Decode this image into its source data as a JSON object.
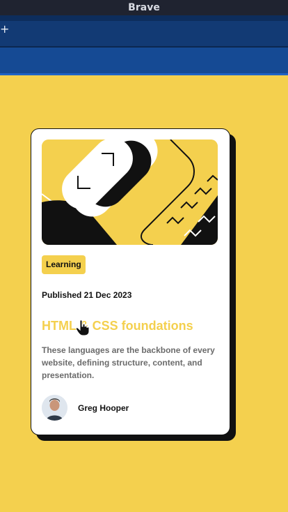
{
  "window": {
    "title": "Brave"
  },
  "tabstrip": {
    "new_tab_glyph": "+"
  },
  "card": {
    "tag": "Learning",
    "published": "Published 21 Dec 2023",
    "headline": "HTML & CSS foundations",
    "description": "These languages are the backbone of every website, defining structure, content, and presentation.",
    "author": "Greg Hooper"
  },
  "colors": {
    "accent": "#f4d04e",
    "ink": "#111111",
    "muted": "#6b6b6b"
  }
}
